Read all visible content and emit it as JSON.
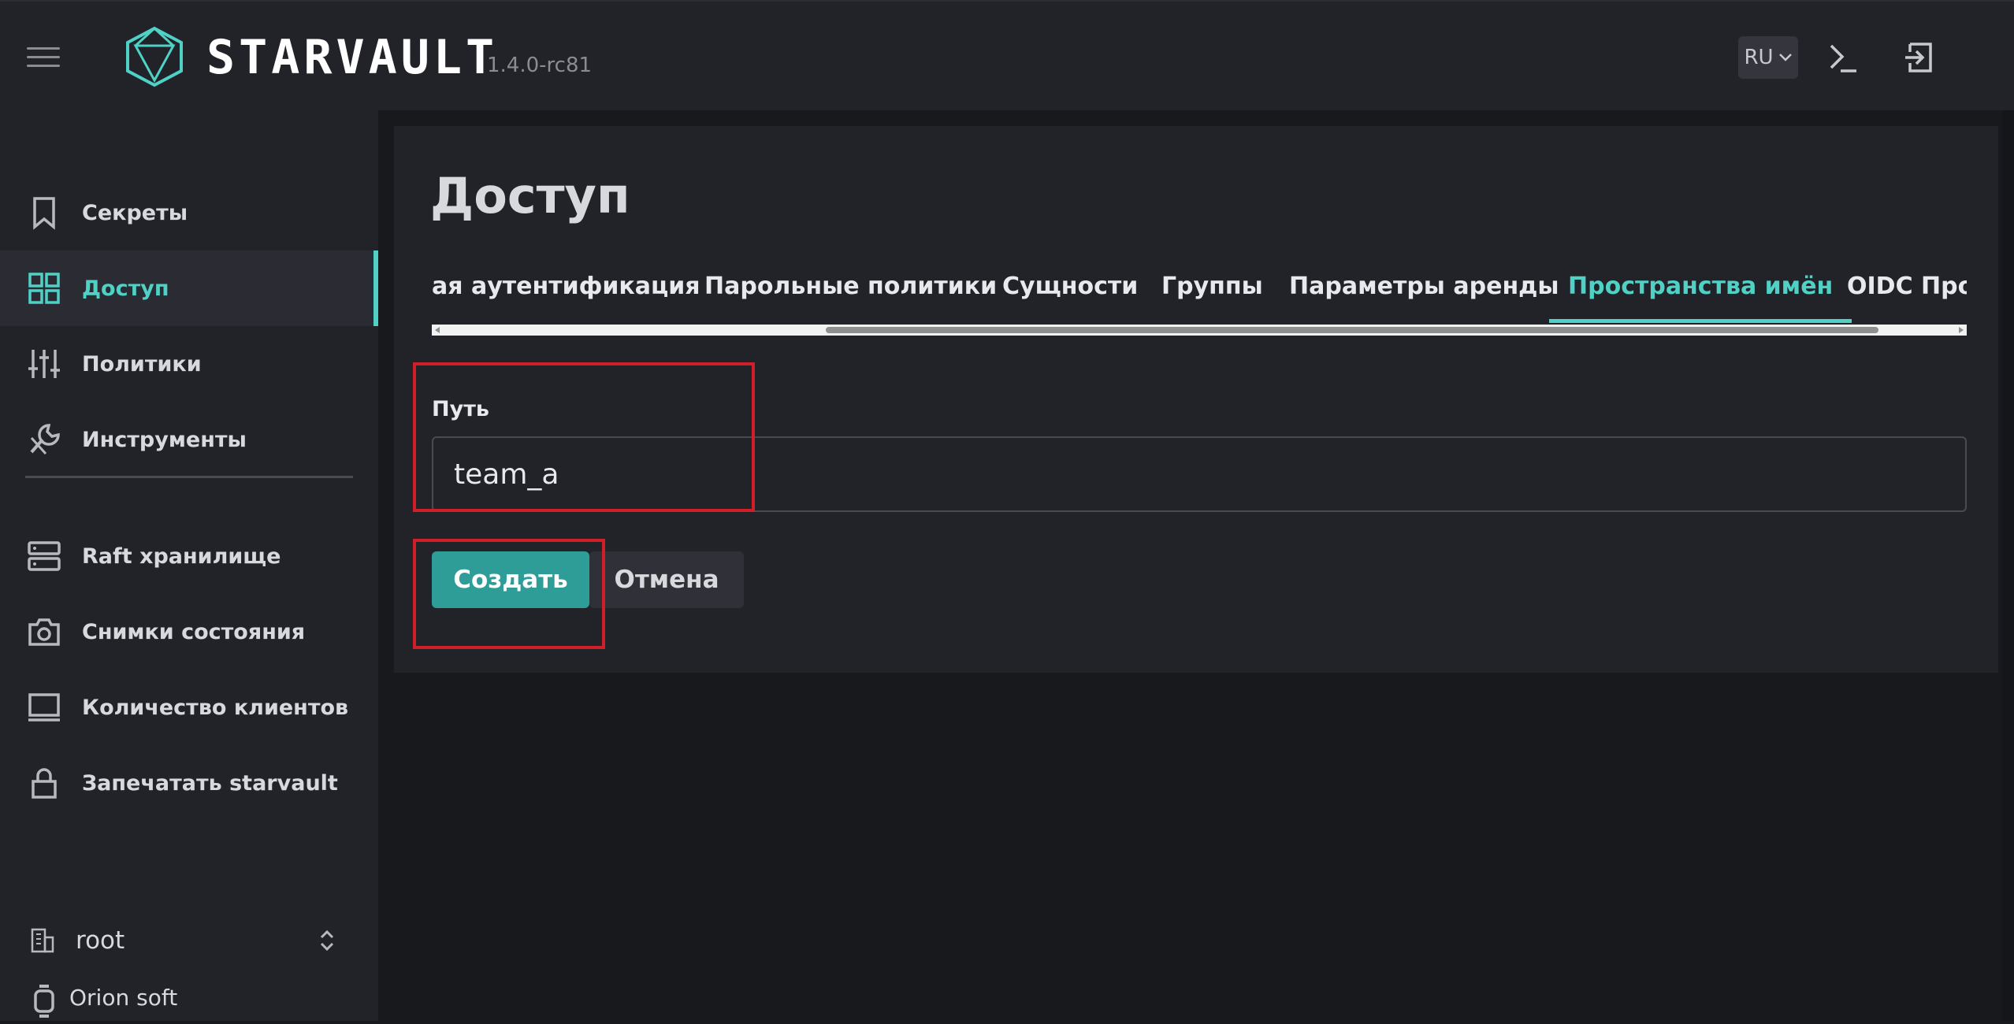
{
  "header": {
    "brand": "STARVAULT",
    "version": "1.4.0-rc81",
    "language": "RU",
    "icons": [
      "menu-icon",
      "starvault-logo-icon",
      "chevron-down-icon",
      "terminal-icon",
      "logout-icon"
    ]
  },
  "sidebar": {
    "items": [
      {
        "label": "Секреты",
        "icon": "bookmark-icon"
      },
      {
        "label": "Доступ",
        "icon": "grid-icon",
        "active": true
      },
      {
        "label": "Политики",
        "icon": "sliders-icon"
      },
      {
        "label": "Инструменты",
        "icon": "wrench-icon"
      },
      {
        "label": "Raft хранилище",
        "icon": "server-icon"
      },
      {
        "label": "Снимки состояния",
        "icon": "camera-icon"
      },
      {
        "label": "Количество клиентов",
        "icon": "monitor-icon"
      },
      {
        "label": "Запечатать starvault",
        "icon": "lock-icon"
      }
    ],
    "namespace": {
      "label": "root",
      "icon": "building-icon"
    },
    "vendor": {
      "label": "Orion soft",
      "icon": "watch-icon"
    }
  },
  "main": {
    "title": "Доступ",
    "tabs": [
      {
        "label": "ая аутентификация"
      },
      {
        "label": "Парольные политики"
      },
      {
        "label": "Сущности"
      },
      {
        "label": "Группы"
      },
      {
        "label": "Параметры аренды"
      },
      {
        "label": "Пространства имён",
        "active": true
      },
      {
        "label": "OIDC Прова"
      }
    ],
    "form": {
      "path_label": "Путь",
      "path_value": "team_a"
    },
    "buttons": {
      "create": "Создать",
      "cancel": "Отмена"
    }
  },
  "colors": {
    "accent": "#4fd1c5",
    "primary_button": "#2e9d97",
    "highlight": "#d11f2a",
    "background": "#18191d",
    "panel": "#222329"
  }
}
